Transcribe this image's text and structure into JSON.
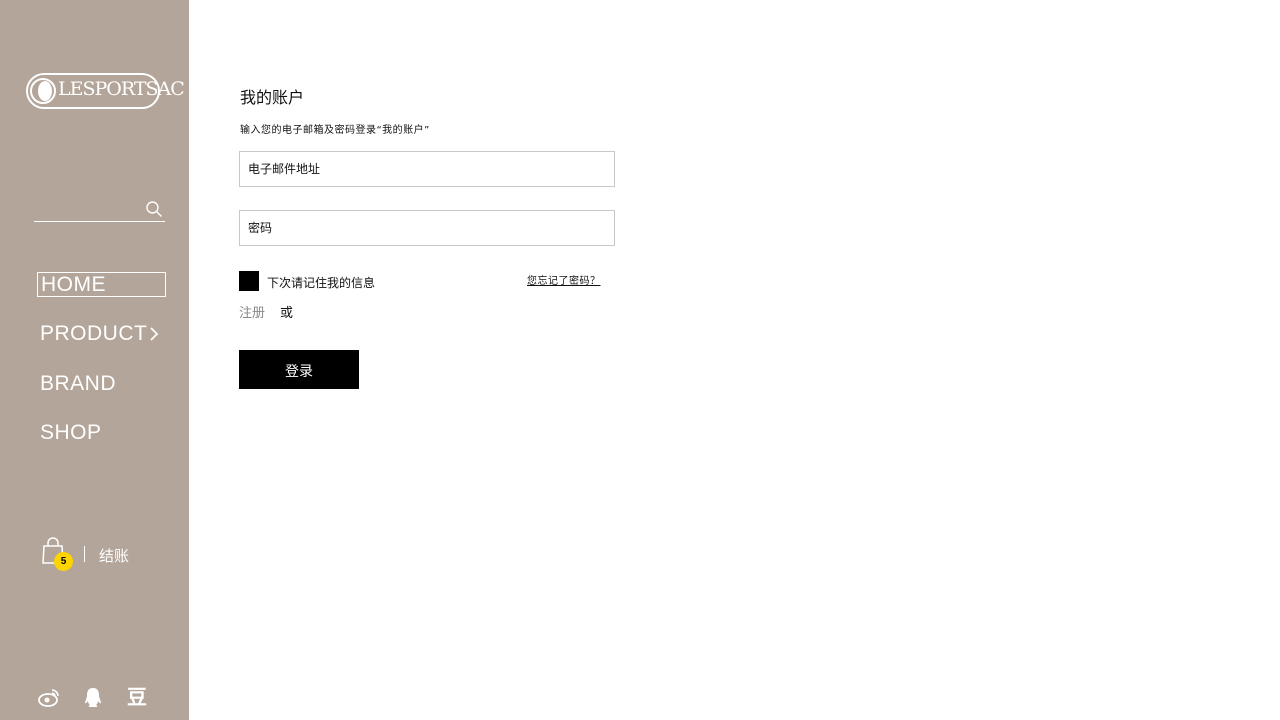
{
  "brand": {
    "logo_text": "LESPORTSAC"
  },
  "search": {
    "placeholder": ""
  },
  "nav": {
    "items": [
      {
        "label": "HOME"
      },
      {
        "label": "PRODUCT"
      },
      {
        "label": "BRAND"
      },
      {
        "label": "SHOP"
      }
    ]
  },
  "cart": {
    "count": "5",
    "checkout_label": "结账"
  },
  "social": {
    "icons": [
      "weibo-icon",
      "qq-icon",
      "douban-icon"
    ],
    "douban_glyph": "豆"
  },
  "main": {
    "title": "我的账户",
    "subtitle": "输入您的电子邮箱及密码登录“我的账户”",
    "email_placeholder": "电子邮件地址",
    "password_placeholder": "密码",
    "remember_label": "下次请记住我的信息",
    "forgot_label": "您忘记了密码？",
    "register_label": "注册",
    "or_label": "或",
    "login_label": "登录"
  },
  "colors": {
    "sidebar": "#b3a599",
    "badge": "#ffd500",
    "button": "#000000"
  }
}
